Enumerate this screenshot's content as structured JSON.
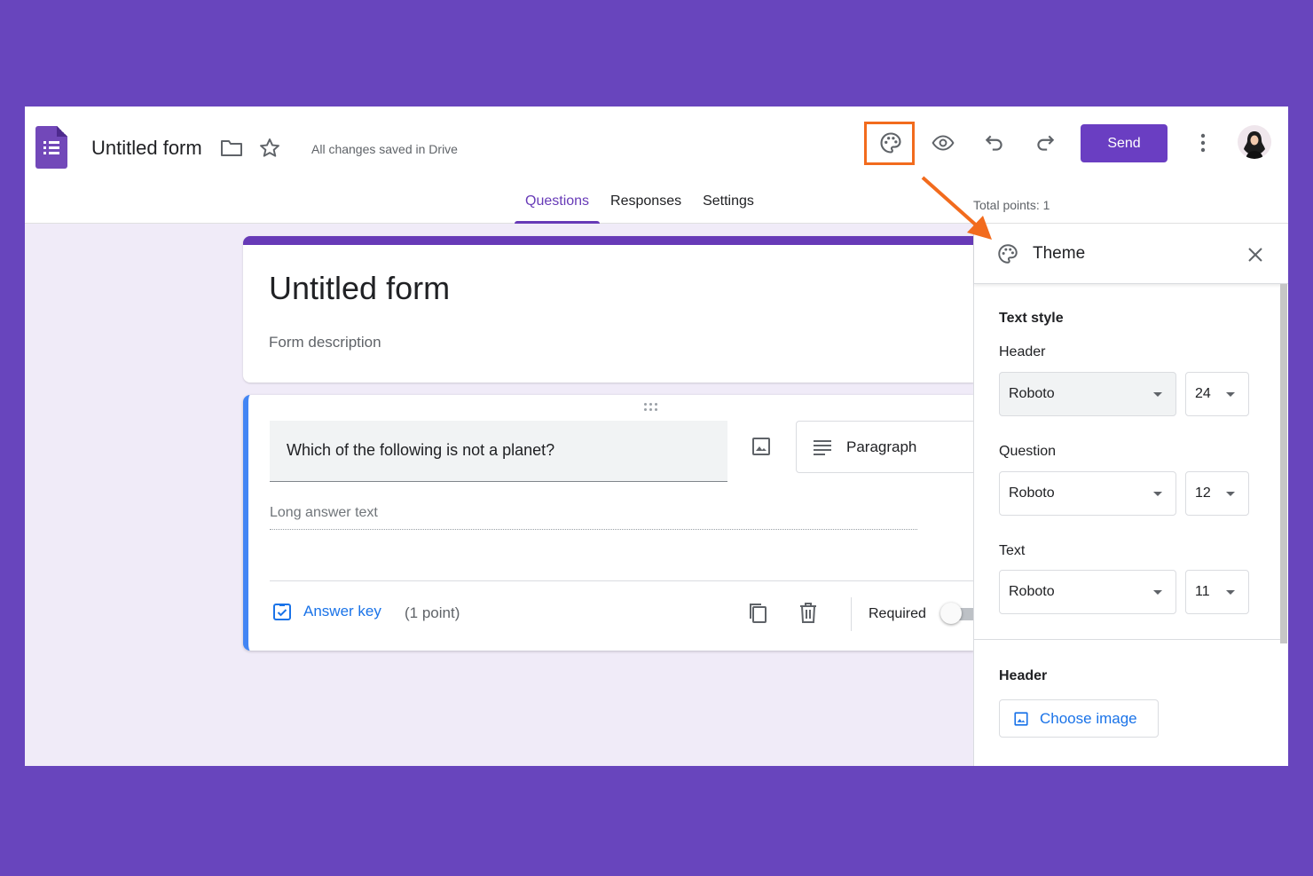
{
  "header": {
    "doc_title": "Untitled form",
    "saved_status": "All changes saved in Drive",
    "send_label": "Send"
  },
  "tabs": [
    {
      "label": "Questions",
      "active": true
    },
    {
      "label": "Responses",
      "active": false
    },
    {
      "label": "Settings",
      "active": false
    }
  ],
  "total_points": "Total points: 1",
  "form": {
    "title": "Untitled form",
    "description": "Form description"
  },
  "question": {
    "text": "Which of the following is not a planet?",
    "type": "Paragraph",
    "long_answer_placeholder": "Long answer text",
    "answer_key_label": "Answer key",
    "points": "(1 point)",
    "required_label": "Required",
    "required_on": false
  },
  "theme_panel": {
    "title": "Theme",
    "text_style_heading": "Text style",
    "header_label": "Header",
    "header_font": "Roboto",
    "header_size": "24",
    "question_label": "Question",
    "question_font": "Roboto",
    "question_size": "12",
    "text_label": "Text",
    "text_font": "Roboto",
    "text_size": "11",
    "header_section_heading": "Header",
    "choose_image_label": "Choose image"
  },
  "colors": {
    "page_background": "#6845bd",
    "accent": "#673ab7",
    "link": "#1a73e8",
    "highlight": "#f26b1d",
    "question_border": "#4285f4"
  },
  "icons": [
    "forms-logo-icon",
    "folder-icon",
    "star-icon",
    "palette-icon",
    "eye-icon",
    "undo-icon",
    "redo-icon",
    "more-vert-icon",
    "image-icon",
    "paragraph-icon",
    "checklist-icon",
    "copy-icon",
    "trash-icon",
    "close-icon",
    "drag-handle-icon"
  ]
}
